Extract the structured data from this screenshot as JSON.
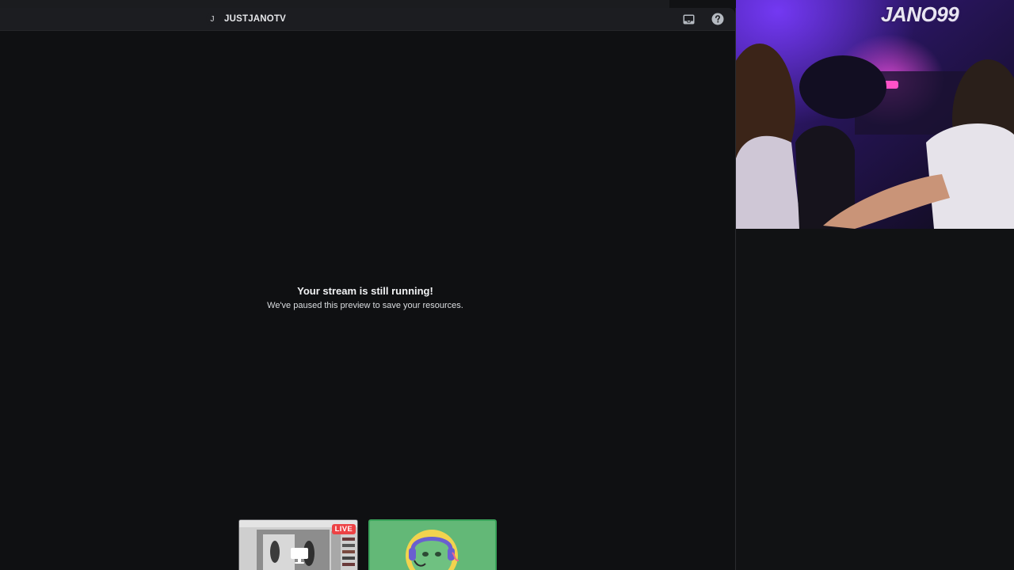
{
  "window": {
    "title": "JUSTJANOTV",
    "avatar_letter": "J"
  },
  "icons": {
    "inbox": "inbox-icon",
    "help": "help-icon",
    "monitor": "monitor-icon"
  },
  "paused": {
    "title": "Your stream is still running!",
    "subtitle": "We've paused this preview to save your resources."
  },
  "participants": [
    {
      "kind": "stream",
      "badge": "LIVE"
    },
    {
      "kind": "user-avatar",
      "speaking": true
    }
  ],
  "webcam": {
    "overlay_name": "JANO99"
  },
  "colors": {
    "live": "#ed4245",
    "speaking": "#3ba55c",
    "avatar_bg": "#63b877",
    "window_bg": "#0f1012",
    "titlebar_bg": "#1c1d21"
  }
}
